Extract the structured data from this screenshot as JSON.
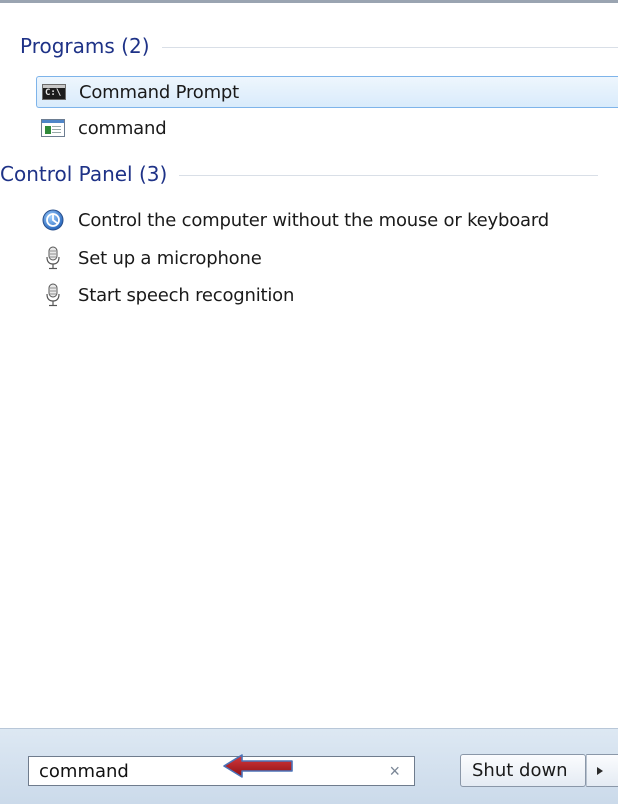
{
  "results": {
    "groups": [
      {
        "title": "Programs (2)",
        "items": [
          {
            "label": "Command Prompt",
            "icon": "command-prompt-icon",
            "selected": true
          },
          {
            "label": "command",
            "icon": "application-window-icon",
            "selected": false
          }
        ]
      },
      {
        "title": "Control Panel (3)",
        "items": [
          {
            "label": "Control the computer without the mouse or keyboard",
            "icon": "ease-of-access-icon",
            "selected": false
          },
          {
            "label": "Set up a microphone",
            "icon": "microphone-icon",
            "selected": false
          },
          {
            "label": "Start speech recognition",
            "icon": "microphone-icon",
            "selected": false
          }
        ]
      }
    ]
  },
  "search": {
    "value": "command",
    "clear_icon": "×"
  },
  "shutdown": {
    "label": "Shut down",
    "menu_icon": "triangle-right-icon"
  },
  "annotation": {
    "icon": "red-arrow-left-icon",
    "color": "#b2191f"
  },
  "colors": {
    "group_title": "#1e3287",
    "selection_border": "#7eb4ea",
    "bottom_bar": "#d4e1ee"
  }
}
